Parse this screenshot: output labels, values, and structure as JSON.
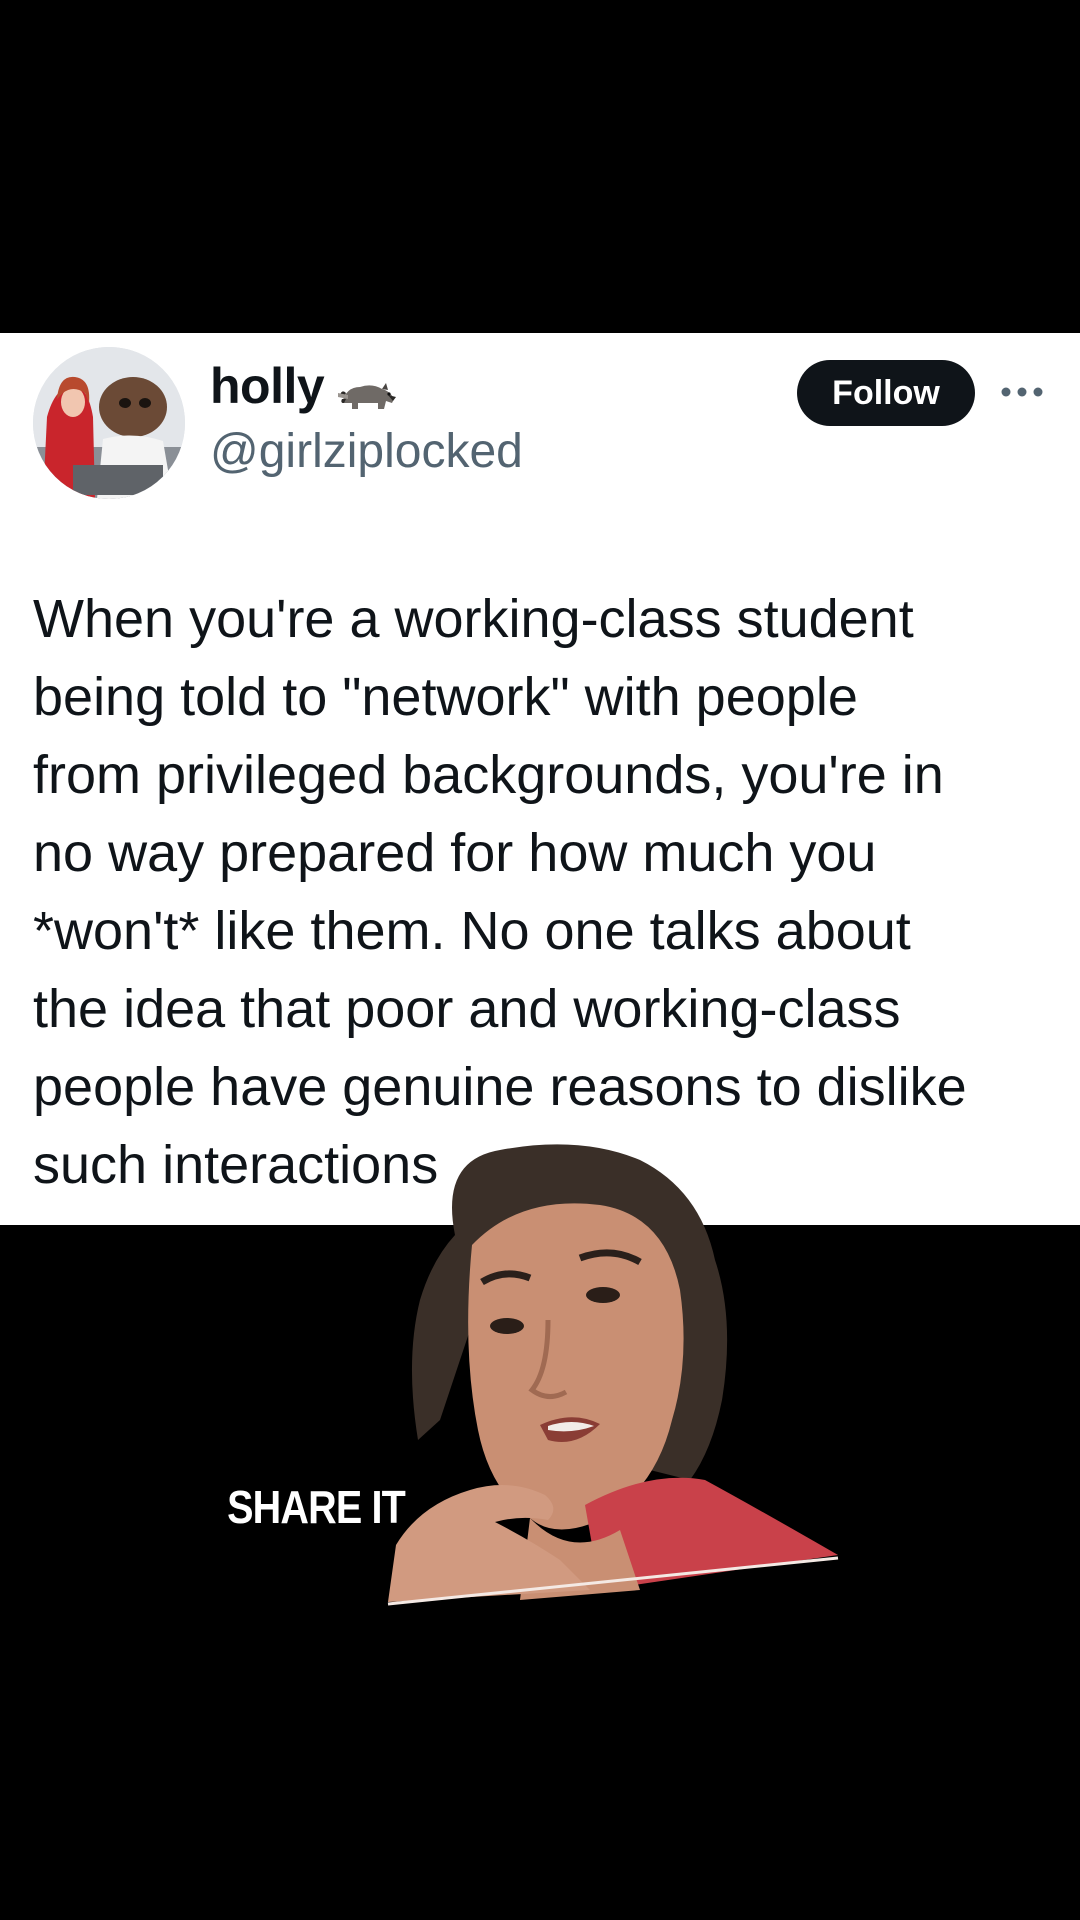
{
  "tweet": {
    "display_name": "holly",
    "name_emoji": "raccoon-icon",
    "handle": "@girlziplocked",
    "follow_label": "Follow",
    "more_icon": "more-dots-icon",
    "text": "When you're a working-class student\nbeing told to \"network\" with people\nfrom privileged backgrounds, you're in\nno way prepared for how much you\n*won't* like them. No one talks about\nthe idea that poor and working-class\npeople have genuine reasons to dislike\nsuch interactions"
  },
  "video": {
    "caption": "SHARE IT"
  },
  "colors": {
    "text_primary": "#0f1419",
    "text_secondary": "#536471",
    "follow_bg": "#0f1419",
    "background": "#000000",
    "card": "#ffffff"
  }
}
